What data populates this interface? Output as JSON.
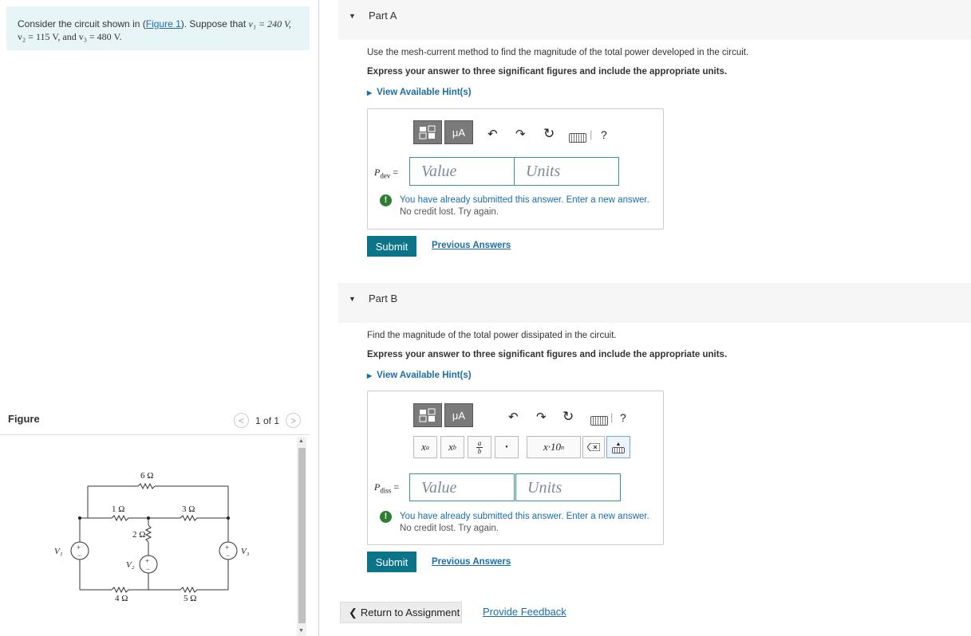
{
  "problem": {
    "intro_1": "Consider the circuit shown in (",
    "figure_link": "Figure 1",
    "intro_2": "). Suppose that ",
    "line2": "v₂ = 115 V, and v₃ = 480 V.",
    "v1_text": "v₁ = 240 V,"
  },
  "figure": {
    "header": "Figure",
    "counter": "1 of 1",
    "prev_glyph": "<",
    "next_glyph": ">",
    "labels": {
      "r6": "6 Ω",
      "r1": "1 Ω",
      "r3": "3 Ω",
      "r2": "2 Ω",
      "r4": "4 Ω",
      "r5": "5 Ω",
      "v1": "V₁",
      "v2": "V₂",
      "v3": "V₃",
      "plus": "+",
      "minus": "−"
    }
  },
  "partA": {
    "title": "Part A",
    "question": "Use the mesh-current method to find the magnitude of the total power developed in the circuit.",
    "instruction": "Express your answer to three significant figures and include the appropriate units.",
    "hint": "View Available Hint(s)",
    "var_label": "P",
    "var_sub": "dev",
    "eq": "=",
    "value_placeholder": "Value",
    "units_placeholder": "Units",
    "warn_1": "You have already submitted this answer. Enter a new answer.",
    "warn_2": "No credit lost. Try again.",
    "submit": "Submit",
    "previous": "Previous Answers",
    "mu_a": "μA",
    "help": "?"
  },
  "partB": {
    "title": "Part B",
    "question": "Find the magnitude of the total power dissipated in the circuit.",
    "instruction": "Express your answer to three significant figures and include the appropriate units.",
    "hint": "View Available Hint(s)",
    "var_label": "P",
    "var_sub": "diss",
    "eq": "=",
    "value_placeholder": "Value",
    "units_placeholder": "Units",
    "warn_1": "You have already submitted this answer. Enter a new answer.",
    "warn_2": "No credit lost. Try again.",
    "submit": "Submit",
    "previous": "Previous Answers",
    "mu_a": "μA",
    "help": "?",
    "tmpl_xa": "x",
    "tmpl_xa_sup": "a",
    "tmpl_xb": "x",
    "tmpl_xb_sub": "b",
    "tmpl_frac_top": "a",
    "tmpl_frac_bot": "b",
    "tmpl_dot": "•",
    "tmpl_sci": "x·10",
    "tmpl_sci_sup": "n"
  },
  "footer": {
    "return": "Return to Assignment",
    "feedback": "Provide Feedback"
  },
  "colors": {
    "accent": "#0c7489",
    "link": "#1a6ea8",
    "success": "#2e7d32"
  }
}
